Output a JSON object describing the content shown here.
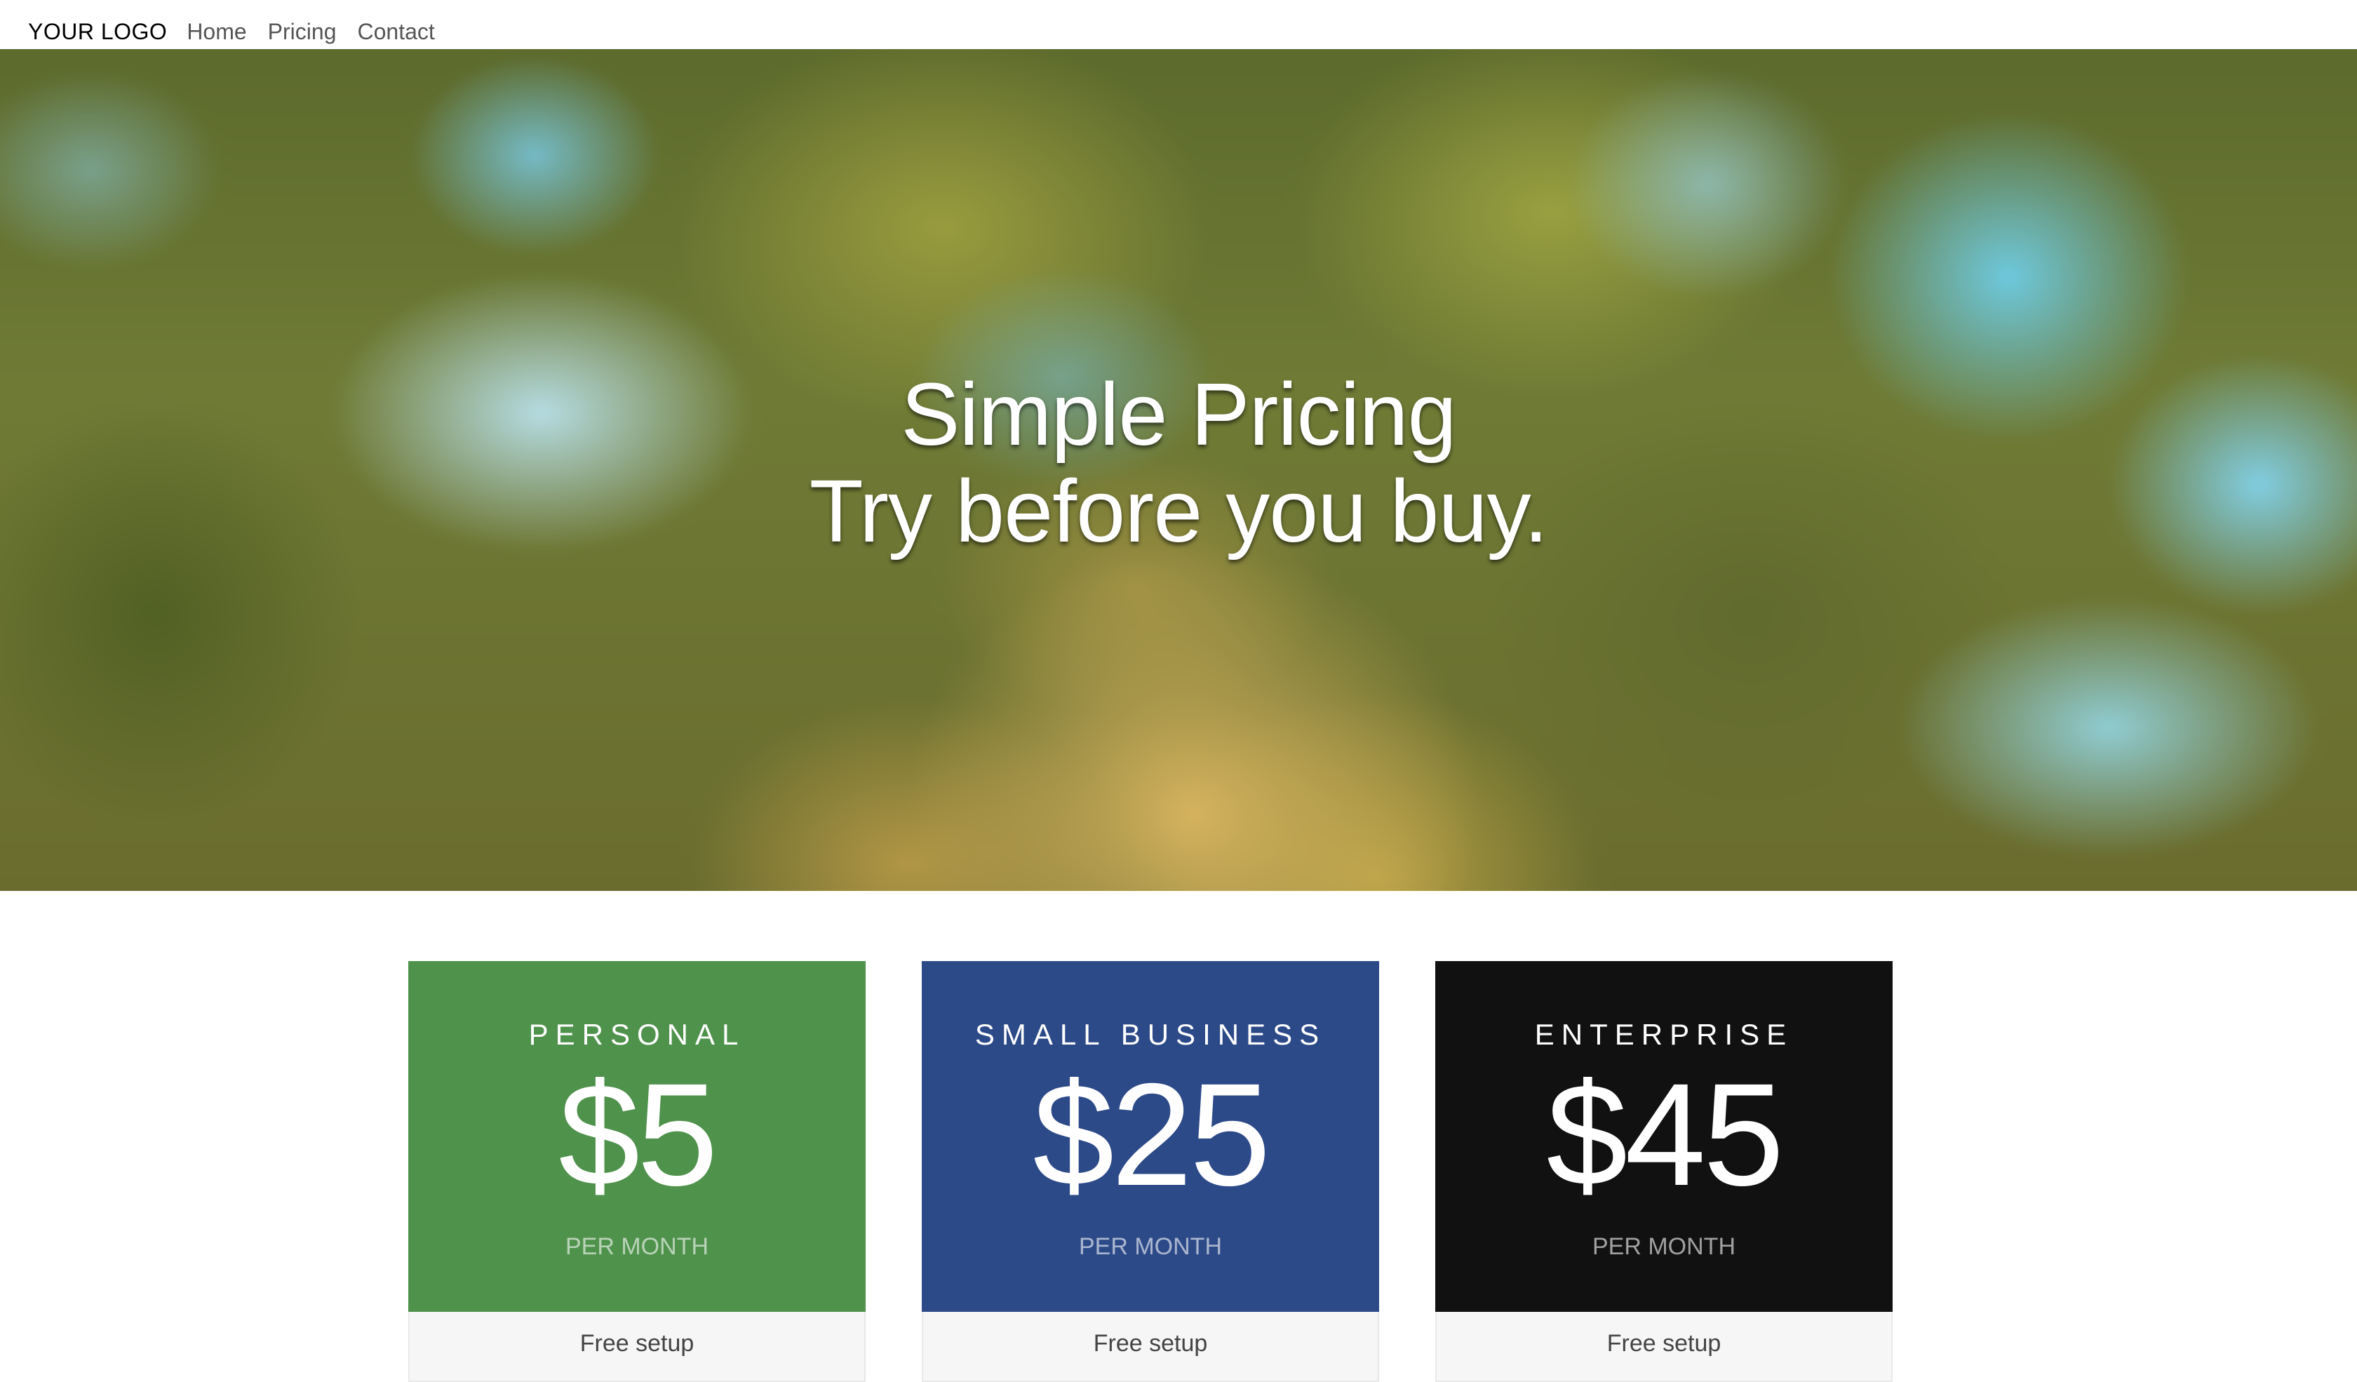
{
  "nav": {
    "logo": "YOUR LOGO",
    "links": [
      "Home",
      "Pricing",
      "Contact"
    ]
  },
  "hero": {
    "line1": "Simple Pricing",
    "line2": "Try before you buy."
  },
  "plans": [
    {
      "name": "PERSONAL",
      "price": "$5",
      "period": "PER MONTH",
      "feature": "Free setup",
      "color": "#4f924c"
    },
    {
      "name": "SMALL BUSINESS",
      "price": "$25",
      "period": "PER MONTH",
      "feature": "Free setup",
      "color": "#2c4988"
    },
    {
      "name": "ENTERPRISE",
      "price": "$45",
      "period": "PER MONTH",
      "feature": "Free setup",
      "color": "#111111"
    }
  ]
}
